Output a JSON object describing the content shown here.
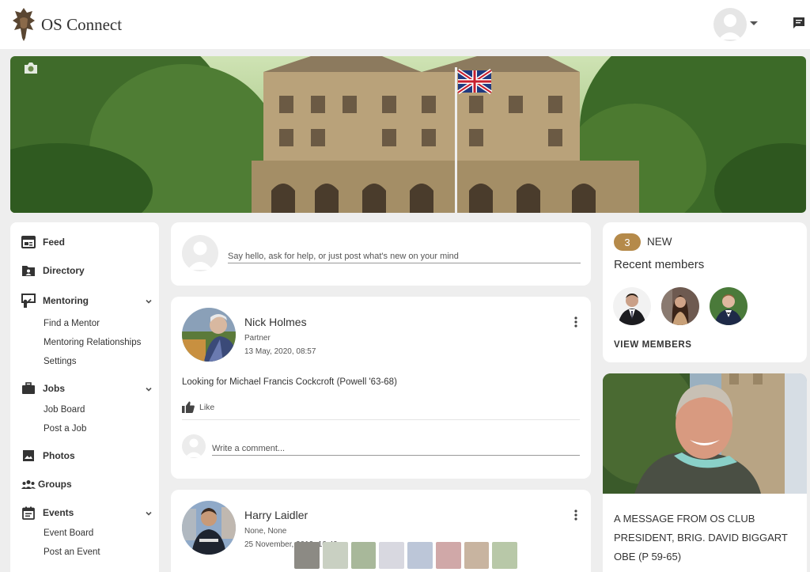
{
  "header": {
    "brand": "OS Connect"
  },
  "sidebar": {
    "items": [
      {
        "label": "Feed",
        "icon": "feed-icon"
      },
      {
        "label": "Directory",
        "icon": "directory-icon"
      },
      {
        "label": "Mentoring",
        "icon": "mentoring-icon",
        "sub": [
          "Find a Mentor",
          "Mentoring Relationships",
          "Settings"
        ]
      },
      {
        "label": "Jobs",
        "icon": "briefcase-icon",
        "sub": [
          "Job Board",
          "Post a Job"
        ]
      },
      {
        "label": "Photos",
        "icon": "photo-icon"
      },
      {
        "label": "Groups",
        "icon": "groups-icon"
      },
      {
        "label": "Events",
        "icon": "calendar-icon",
        "sub": [
          "Event Board",
          "Post an Event"
        ]
      }
    ]
  },
  "composer": {
    "placeholder": "Say hello, ask for help, or just post what's new on your mind"
  },
  "posts": [
    {
      "author": "Nick Holmes",
      "role": "Partner",
      "date": "13 May, 2020, 08:57",
      "text": "Looking for Michael Francis Cockcroft (Powell '63-68)",
      "like_label": "Like",
      "comment_placeholder": "Write a comment..."
    },
    {
      "author": "Harry Laidler",
      "role": "None, None",
      "date": "25 November, 2019, 10:49"
    }
  ],
  "members": {
    "count": "3",
    "new_label": "NEW",
    "title": "Recent members",
    "view_label": "VIEW MEMBERS"
  },
  "promo": {
    "text": "A message from OS Club President, Brig. David Biggart OBE (P 59-65)"
  },
  "colors": {
    "accent": "#b58a4a",
    "background": "#eeeeee",
    "card": "#ffffff"
  }
}
